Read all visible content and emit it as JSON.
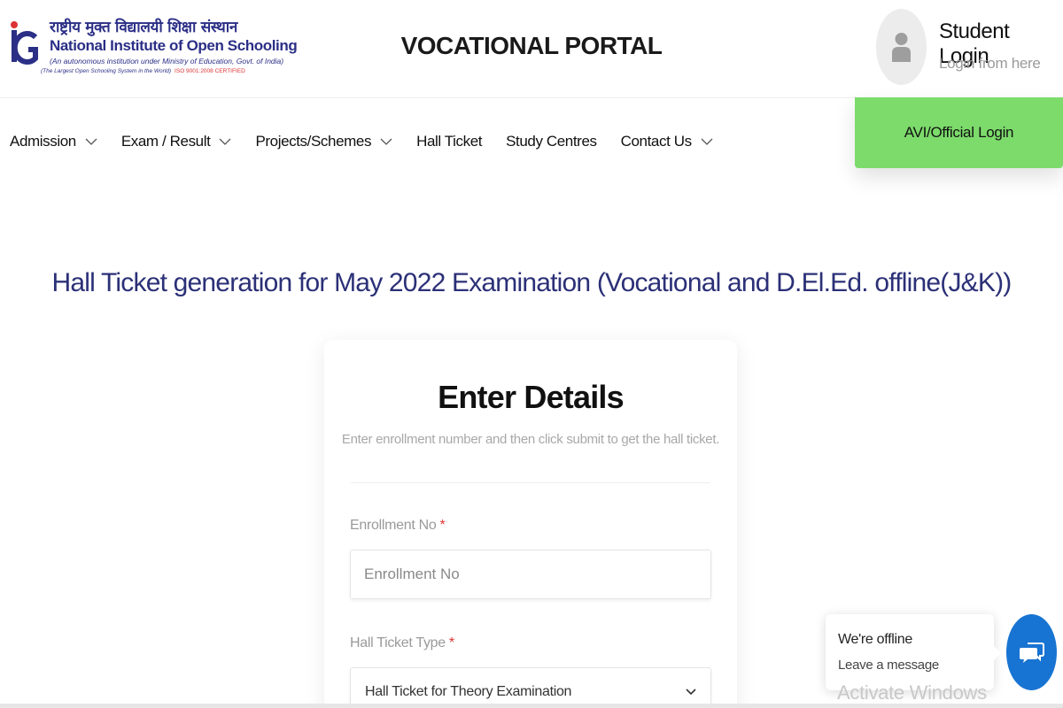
{
  "header": {
    "logo": {
      "hindi": "राष्ट्रीय मुक्त विद्यालयी शिक्षा संस्थान",
      "name_part1": "National Institute of ",
      "name_part2": "Open Schooling",
      "sub": "(An autonomous institution under Ministry of Education, Govt. of India)",
      "sub2": "(The Largest Open Schooling System in the World)",
      "iso": "ISO 9001:2008 CERTIFIED",
      "brand_color": "#2b2f86"
    },
    "portal_title": "VOCATIONAL PORTAL",
    "student_login": {
      "title": "Student Login",
      "subtitle": "Login from here"
    }
  },
  "nav": {
    "items": [
      {
        "label": "Admission",
        "dropdown": true
      },
      {
        "label": "Exam / Result",
        "dropdown": true
      },
      {
        "label": "Projects/Schemes",
        "dropdown": true
      },
      {
        "label": "Hall Ticket",
        "dropdown": false
      },
      {
        "label": "Study Centres",
        "dropdown": false
      },
      {
        "label": "Contact Us",
        "dropdown": true
      }
    ],
    "avi_login": "AVI/Official Login",
    "avi_color": "#7cdb6b"
  },
  "main": {
    "heading": "Hall Ticket generation for May 2022 Examination (Vocational and D.El.Ed. offline(J&K))",
    "form": {
      "title": "Enter Details",
      "subtitle": "Enter enrollment number and then click submit to get the hall ticket.",
      "enrollment_label": "Enrollment No",
      "enrollment_placeholder": "Enrollment No",
      "enrollment_value": "",
      "ticket_type_label": "Hall Ticket Type",
      "ticket_type_selected": "Hall Ticket for Theory Examination",
      "required_mark": "*"
    }
  },
  "chat": {
    "status": "We're offline",
    "message": "Leave a message",
    "button_color": "#1874d2"
  },
  "watermark": "Activate Windows"
}
